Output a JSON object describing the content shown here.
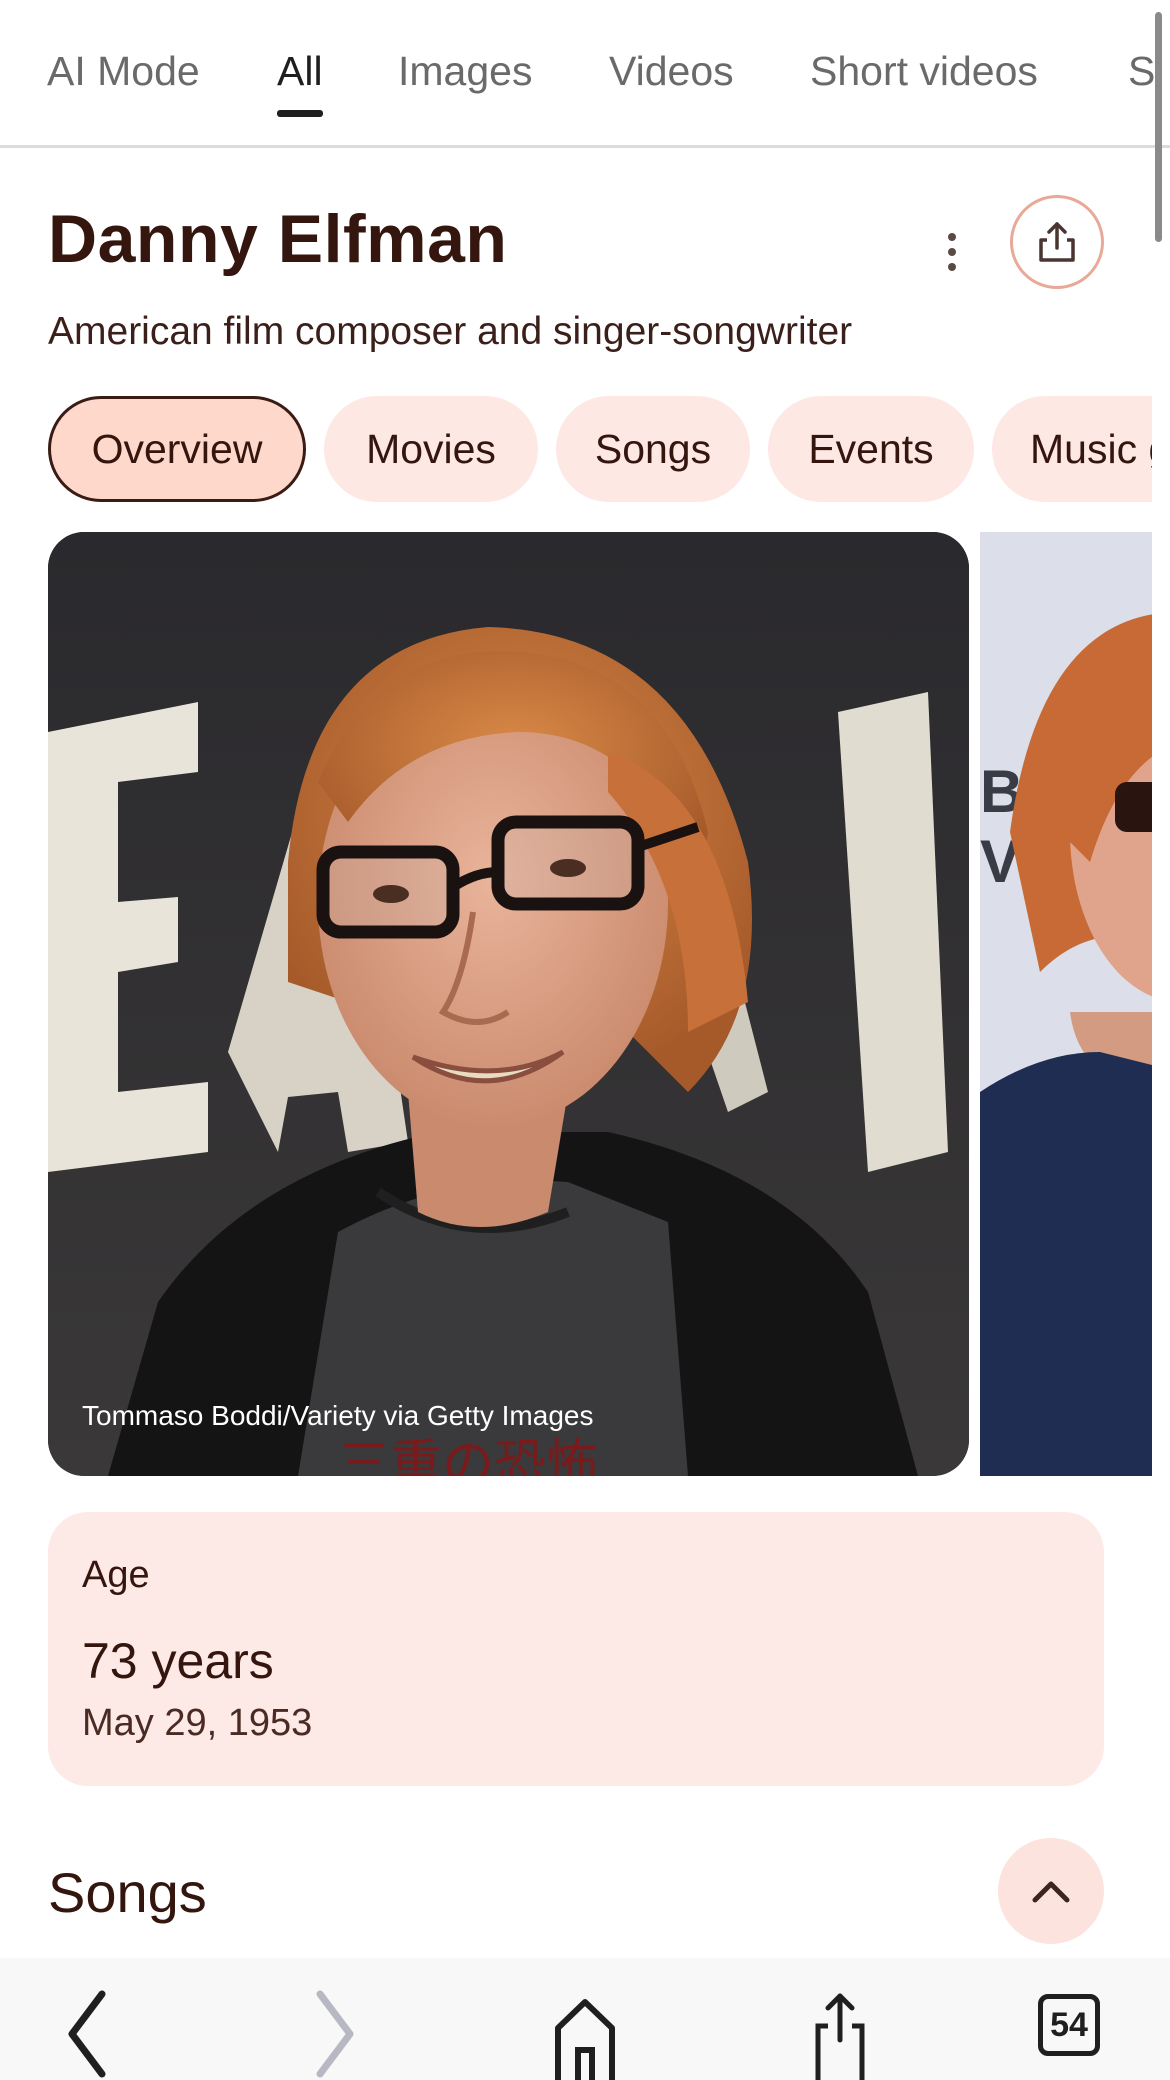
{
  "search_tabs": [
    {
      "label": "AI Mode",
      "active": false
    },
    {
      "label": "All",
      "active": true
    },
    {
      "label": "Images",
      "active": false
    },
    {
      "label": "Videos",
      "active": false
    },
    {
      "label": "Short videos",
      "active": false
    },
    {
      "label": "S",
      "active": false
    }
  ],
  "header": {
    "title": "Danny Elfman",
    "subtitle": "American film composer and singer-songwriter",
    "more_icon": "more-vert-icon",
    "share_icon": "share-icon"
  },
  "chips": [
    {
      "label": "Overview",
      "active": true
    },
    {
      "label": "Movies",
      "active": false
    },
    {
      "label": "Songs",
      "active": false
    },
    {
      "label": "Events",
      "active": false
    },
    {
      "label": "Music g",
      "active": false
    }
  ],
  "photos": {
    "main_credit": "Tommaso Boddi/Variety via Getty Images",
    "backdrop_text": "EAM",
    "second_backdrop_text": "B\nV"
  },
  "age_card": {
    "label": "Age",
    "value": "73 years",
    "date": "May 29, 1953"
  },
  "songs_section": {
    "title": "Songs",
    "collapse_icon": "chevron-up-icon"
  },
  "bottom_bar": {
    "tab_count": "54",
    "icons": [
      "back-icon",
      "forward-icon",
      "home-icon",
      "share-icon",
      "tabs-icon"
    ]
  },
  "colors": {
    "accent_text": "#34160f",
    "chip_bg": "#fde8e4",
    "chip_active_bg": "#ffd8cc",
    "card_bg": "#fde9e5"
  }
}
